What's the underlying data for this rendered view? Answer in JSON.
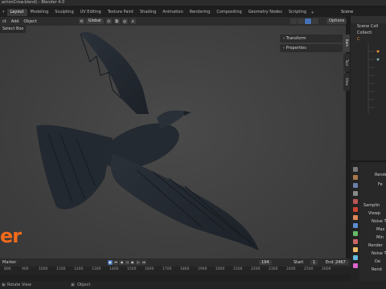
{
  "window": {
    "title": "arrionCrow.blend) - Blender 4.0"
  },
  "workspace_tabs": [
    "Layout",
    "Modeling",
    "Sculpting",
    "UV Editing",
    "Texture Paint",
    "Shading",
    "Animation",
    "Rendering",
    "Compositing",
    "Geometry Nodes",
    "Scripting"
  ],
  "workspace_plus": "+",
  "scene_label": "Scene",
  "viewport_header": {
    "menus": [
      "ct",
      "Add",
      "Object"
    ],
    "orientation": "Global",
    "options": "Options",
    "select_box": "Select Box"
  },
  "npanel": {
    "rows": [
      "Transform",
      "Properties"
    ],
    "tabs": [
      "Item",
      "Tool",
      "View"
    ]
  },
  "outliner": {
    "rows": [
      "Scene Coll",
      "Collecti",
      "C",
      "",
      "",
      "",
      "",
      "",
      ""
    ]
  },
  "properties": {
    "rows": [
      "Rende",
      "Fe",
      "Samplin",
      "Viewp",
      "Noise T",
      "Max",
      "Min",
      "Render",
      "Noise T",
      "De",
      "Rend"
    ]
  },
  "logo": {
    "text": "er",
    "color": "#f26a1b"
  },
  "timeline": {
    "marker_label": "Marker",
    "current_frame": "194",
    "start_label": "Start",
    "start_value": "1",
    "end_label": "End",
    "end_value": "2467",
    "ruler": [
      "800",
      "900",
      "1000",
      "1100",
      "1200",
      "1300",
      "1400",
      "1500",
      "1600",
      "1700",
      "1800",
      "1900",
      "2000",
      "2100",
      "2200",
      "2300",
      "2400",
      "2500",
      "2600"
    ]
  },
  "statusbar": {
    "left": "Rotate View",
    "right": "Object"
  },
  "colors": {
    "accent": "#4772b3",
    "bg": "#3f3f3f"
  },
  "icons": [
    "play-icon",
    "rewind-icon",
    "forward-icon",
    "record-icon",
    "eye-icon",
    "camera-icon",
    "wrench-icon"
  ]
}
